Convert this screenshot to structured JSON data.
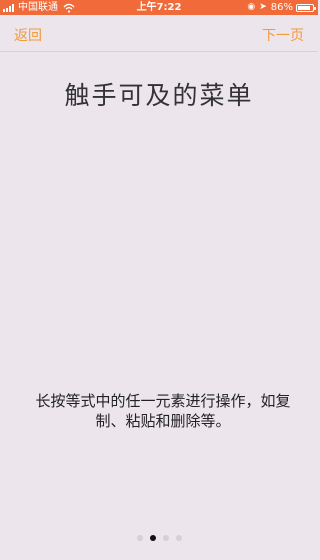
{
  "status_bar": {
    "carrier": "中国联通",
    "time": "上午7:22",
    "battery": "86%",
    "battery_level": 0.86
  },
  "nav": {
    "back_label": "返回",
    "next_label": "下一页"
  },
  "content": {
    "title": "触手可及的菜单",
    "description": "长按等式中的任一元素进行操作，如复制、粘贴和删除等。"
  },
  "pager": {
    "page_count": 4,
    "current_index": 1
  },
  "colors": {
    "status_bar_bg": "#f06a3a",
    "accent": "#f29b3b",
    "background": "#ece5ec"
  }
}
